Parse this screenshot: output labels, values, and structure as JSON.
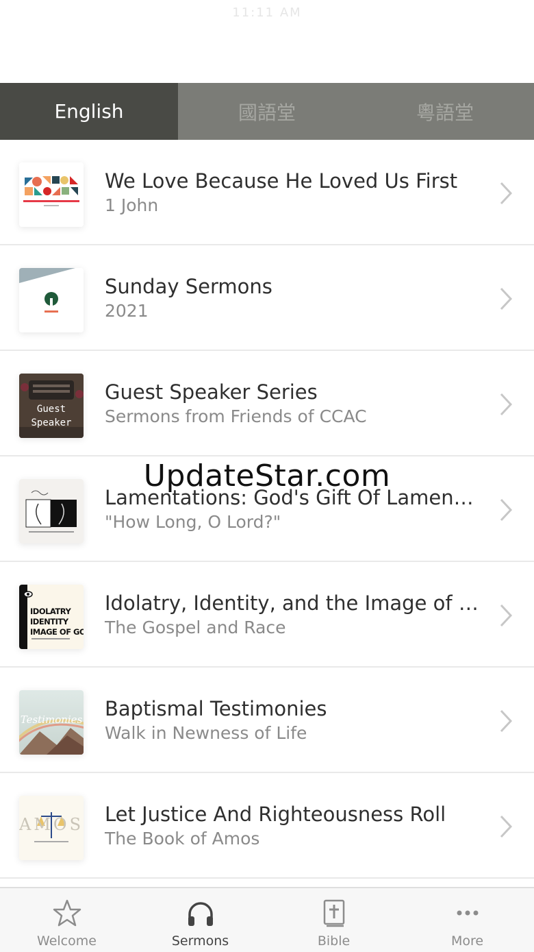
{
  "status": {
    "faint_text": "11:11 AM"
  },
  "tabs": [
    {
      "label": "English",
      "active": true
    },
    {
      "label": "國語堂",
      "active": false
    },
    {
      "label": "粵語堂",
      "active": false
    }
  ],
  "series": [
    {
      "title": "We Love Because He Loved Us First",
      "subtitle": "1 John",
      "thumb": "we-love-art"
    },
    {
      "title": "Sunday Sermons",
      "subtitle": "2021",
      "thumb": "sunday-sermons-logo"
    },
    {
      "title": "Guest Speaker Series",
      "subtitle": "Sermons from Friends of CCAC",
      "thumb": "typewriter-photo",
      "thumb_text": "Guest\nSpeaker"
    },
    {
      "title": "Lamentations: God's Gift Of Lament T...",
      "subtitle": "\"How Long, O Lord?\"",
      "thumb": "lamentations-art"
    },
    {
      "title": "Idolatry, Identity, and the Image of God",
      "subtitle": "The Gospel and Race",
      "thumb": "idolatry-art",
      "thumb_text": "IDOLATRY\nIDENTITY\nIMAGE OF GOD"
    },
    {
      "title": "Baptismal Testimonies",
      "subtitle": "Walk in Newness of Life",
      "thumb": "testimonies-art",
      "thumb_text": "Testimonies"
    },
    {
      "title": "Let Justice And Righteousness Roll",
      "subtitle": "The Book of Amos",
      "thumb": "amos-art",
      "thumb_text": "AMOS"
    }
  ],
  "watermark": "UpdateStar.com",
  "nav": [
    {
      "label": "Welcome",
      "icon": "star-icon",
      "active": false
    },
    {
      "label": "Sermons",
      "icon": "headphones-icon",
      "active": true
    },
    {
      "label": "Bible",
      "icon": "bible-icon",
      "active": false
    },
    {
      "label": "More",
      "icon": "more-icon",
      "active": false
    }
  ],
  "colors": {
    "tab_active": "#494a45",
    "tab_inactive": "#7b7c77",
    "nav_bg": "#f7f7f7"
  }
}
